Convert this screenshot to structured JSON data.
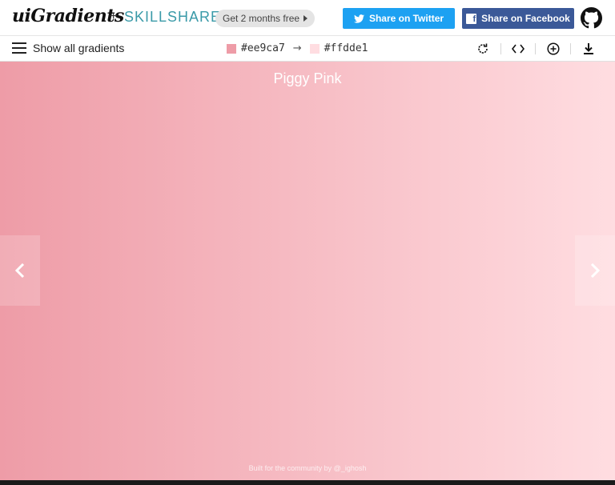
{
  "header": {
    "logo": "uiGradients",
    "plus": "+",
    "partner": "SKILLSHARE",
    "promo": "Get 2 months free",
    "twitter_label": "Share on Twitter",
    "facebook_label": "Share on Facebook"
  },
  "toolbar": {
    "show_all_label": "Show all gradients",
    "color_from": "#ee9ca7",
    "color_to": "#ffdde1",
    "arrow": "→"
  },
  "gradient": {
    "name": "Piggy Pink",
    "footer": "Built for the community by @_ighosh"
  },
  "icons": [
    "twitter-bird",
    "facebook-f",
    "github-octocat",
    "hamburger",
    "rotate",
    "code",
    "add-circle",
    "download",
    "chevron-left",
    "chevron-right",
    "caret-right"
  ],
  "colors": {
    "twitter": "#1da1f2",
    "facebook": "#3b5998",
    "skillshare": "#3a9aa8"
  }
}
